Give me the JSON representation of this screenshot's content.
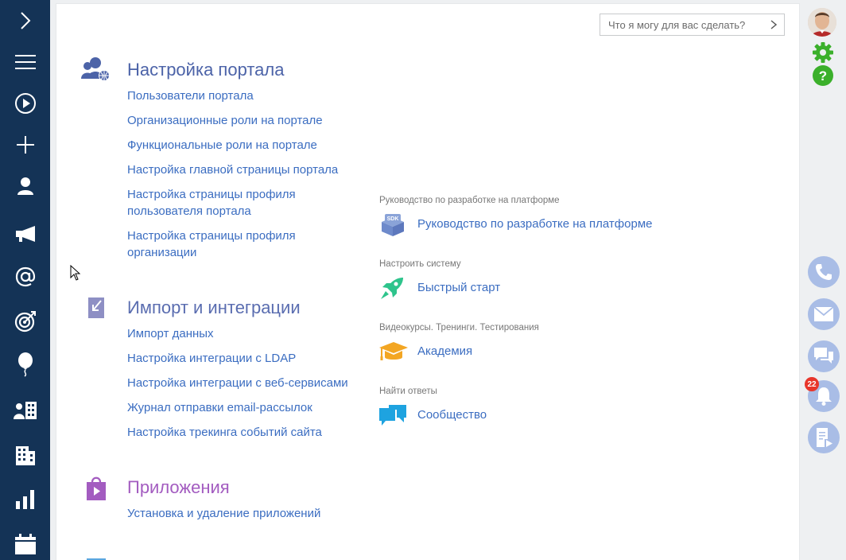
{
  "search": {
    "placeholder": "Что я могу для вас сделать?"
  },
  "sections": [
    {
      "title": "Настройка портала",
      "color": "#4c63a8",
      "links": [
        "Пользователи портала",
        "Организационные роли на портале",
        "Функциональные роли на портале",
        "Настройка главной страницы портала",
        "Настройка страницы профиля пользователя портала",
        "Настройка страницы профиля организации"
      ]
    },
    {
      "title": "Импорт и интеграции",
      "color": "#5a6db0",
      "links": [
        "Импорт данных",
        "Настройка интеграции с LDAP",
        "Настройка интеграции с веб-сервисами",
        "Журнал отправки email-рассылок",
        "Настройка трекинга событий сайта"
      ]
    },
    {
      "title": "Приложения",
      "color": "#a35cc0",
      "links": [
        "Установка и удаление приложений"
      ]
    }
  ],
  "quick_access": [
    {
      "caption": "Руководство по разработке на платформе",
      "link": "Руководство по разработке на платформе",
      "icon": "sdk-box-icon"
    },
    {
      "caption": "Настроить систему",
      "link": "Быстрый старт",
      "icon": "rocket-icon"
    },
    {
      "caption": "Видеокурсы. Тренинги. Тестирования",
      "link": "Академия",
      "icon": "graduation-cap-icon"
    },
    {
      "caption": "Найти ответы",
      "link": "Сообщество",
      "icon": "chat-bubbles-icon"
    }
  ],
  "right_panel": {
    "notification_count": "22"
  },
  "colors": {
    "sidebar": "#143356",
    "link": "#3b6dc1",
    "accent_green": "#3bb02b",
    "circle_button": "#a9bde6"
  }
}
